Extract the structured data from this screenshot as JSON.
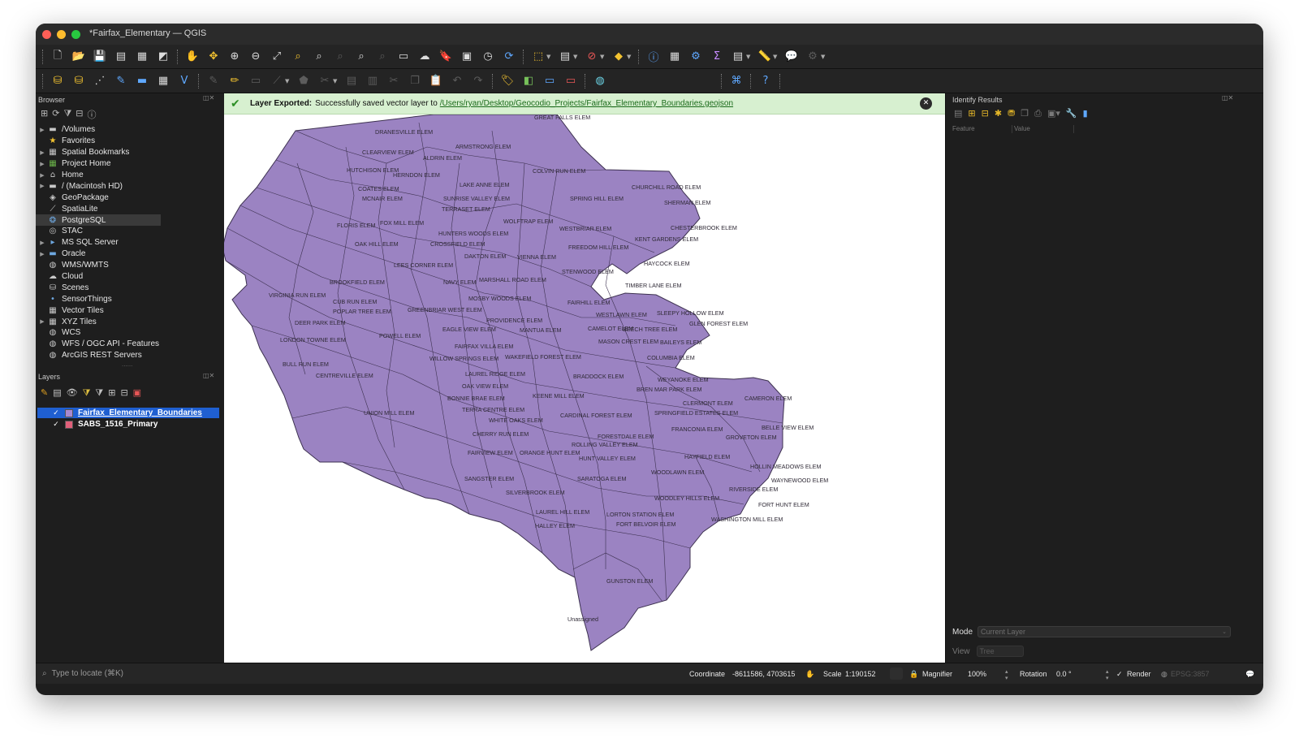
{
  "window": {
    "title": "*Fairfax_Elementary — QGIS"
  },
  "browser_panel": {
    "title": "Browser",
    "items": [
      {
        "label": "/Volumes",
        "icon": "folder-icon",
        "expandable": true
      },
      {
        "label": "Favorites",
        "icon": "star-icon",
        "expandable": false
      },
      {
        "label": "Spatial Bookmarks",
        "icon": "bookmark-icon",
        "expandable": true
      },
      {
        "label": "Project Home",
        "icon": "project-home-icon",
        "expandable": true
      },
      {
        "label": "Home",
        "icon": "home-folder-icon",
        "expandable": true
      },
      {
        "label": "/ (Macintosh HD)",
        "icon": "folder-icon",
        "expandable": true
      },
      {
        "label": "GeoPackage",
        "icon": "geopackage-icon",
        "expandable": false
      },
      {
        "label": "SpatiaLite",
        "icon": "spatialite-icon",
        "expandable": false
      },
      {
        "label": "PostgreSQL",
        "icon": "postgresql-icon",
        "expandable": false,
        "selected": true
      },
      {
        "label": "STAC",
        "icon": "stac-icon",
        "expandable": false
      },
      {
        "label": "MS SQL Server",
        "icon": "mssql-icon",
        "expandable": true
      },
      {
        "label": "Oracle",
        "icon": "oracle-icon",
        "expandable": true
      },
      {
        "label": "WMS/WMTS",
        "icon": "globe-icon",
        "expandable": false
      },
      {
        "label": "Cloud",
        "icon": "cloud-icon",
        "expandable": false
      },
      {
        "label": "Scenes",
        "icon": "scenes-icon",
        "expandable": false
      },
      {
        "label": "SensorThings",
        "icon": "sensor-icon",
        "expandable": false
      },
      {
        "label": "Vector Tiles",
        "icon": "grid-icon",
        "expandable": false
      },
      {
        "label": "XYZ Tiles",
        "icon": "grid-icon",
        "expandable": true
      },
      {
        "label": "WCS",
        "icon": "globe-icon",
        "expandable": false
      },
      {
        "label": "WFS / OGC API - Features",
        "icon": "globe-icon",
        "expandable": false
      },
      {
        "label": "ArcGIS REST Servers",
        "icon": "globe-icon",
        "expandable": false
      }
    ]
  },
  "layers_panel": {
    "title": "Layers",
    "layers": [
      {
        "name": "Fairfax_Elementary_Boundaries",
        "checked": true,
        "color": "#a889cf",
        "selected": true
      },
      {
        "name": "SABS_1516_Primary",
        "checked": true,
        "color": "#e0607a",
        "selected": false
      }
    ]
  },
  "message_bar": {
    "title": "Layer Exported:",
    "text": "Successfully saved vector layer to",
    "path": "/Users/ryan/Desktop/Geocodio_Projects/Fairfax_Elementary_Boundaries.geojson"
  },
  "map": {
    "fill_color": "#9b83c2",
    "stroke_color": "#3d3150",
    "labels": [
      {
        "text": "GREAT FALLS ELEM"
      },
      {
        "text": "DRANESVILLE ELEM"
      },
      {
        "text": "ARMSTRONG ELEM"
      },
      {
        "text": "CLEARVIEW ELEM"
      },
      {
        "text": "ALDRIN ELEM"
      },
      {
        "text": "HUTCHISON ELEM"
      },
      {
        "text": "HERNDON ELEM"
      },
      {
        "text": "COLVIN RUN ELEM"
      },
      {
        "text": "CHURCHILL ROAD ELEM"
      },
      {
        "text": "LAKE ANNE ELEM"
      },
      {
        "text": "COATES ELEM"
      },
      {
        "text": "SUNRISE VALLEY ELEM"
      },
      {
        "text": "SPRING HILL ELEM"
      },
      {
        "text": "SHERMAN ELEM"
      },
      {
        "text": "MCNAIR ELEM"
      },
      {
        "text": "TERRASET ELEM"
      },
      {
        "text": "WOLFTRAP ELEM"
      },
      {
        "text": "FLORIS ELEM"
      },
      {
        "text": "FOX MILL ELEM"
      },
      {
        "text": "WESTBRIAR ELEM"
      },
      {
        "text": "CHESTERBROOK ELEM"
      },
      {
        "text": "HUNTERS WOODS ELEM"
      },
      {
        "text": "KENT GARDENS ELEM"
      },
      {
        "text": "OAK HILL ELEM"
      },
      {
        "text": "CROSSFIELD ELEM"
      },
      {
        "text": "FREEDOM HILL ELEM"
      },
      {
        "text": "DAKTON ELEM"
      },
      {
        "text": "VIENNA ELEM"
      },
      {
        "text": "HAYCOCK ELEM"
      },
      {
        "text": "LEES CORNER ELEM"
      },
      {
        "text": "STENWOOD ELEM"
      },
      {
        "text": "NAVY ELEM"
      },
      {
        "text": "MARSHALL ROAD ELEM"
      },
      {
        "text": "BROOKFIELD ELEM"
      },
      {
        "text": "TIMBER LANE ELEM"
      },
      {
        "text": "VIRGINIA RUN ELEM"
      },
      {
        "text": "MOSBY WOODS ELEM"
      },
      {
        "text": "CUB RUN ELEM"
      },
      {
        "text": "FAIRHILL ELEM"
      },
      {
        "text": "POPLAR TREE ELEM"
      },
      {
        "text": "GREENBRIAR WEST ELEM"
      },
      {
        "text": "SLEEPY HOLLOW ELEM"
      },
      {
        "text": "WESTLAWN ELEM"
      },
      {
        "text": "PROVIDENCE ELEM"
      },
      {
        "text": "GLEN FOREST ELEM"
      },
      {
        "text": "DEER PARK ELEM"
      },
      {
        "text": "EAGLE VIEW ELEM"
      },
      {
        "text": "MANTUA ELEM"
      },
      {
        "text": "CAMELOT ELEM"
      },
      {
        "text": "BEECH TREE ELEM"
      },
      {
        "text": "POWELL ELEM"
      },
      {
        "text": "LONDON TOWNE ELEM"
      },
      {
        "text": "MASON CREST ELEM"
      },
      {
        "text": "BAILEYS ELEM"
      },
      {
        "text": "FAIRFAX VILLA ELEM"
      },
      {
        "text": "WILLOW SPRINGS ELEM"
      },
      {
        "text": "WAKEFIELD FOREST ELEM"
      },
      {
        "text": "COLUMBIA ELEM"
      },
      {
        "text": "BULL RUN ELEM"
      },
      {
        "text": "LAUREL RIDGE ELEM"
      },
      {
        "text": "CENTREVILLE ELEM"
      },
      {
        "text": "BRADDOCK ELEM"
      },
      {
        "text": "WEYANOKE ELEM"
      },
      {
        "text": "OAK VIEW ELEM"
      },
      {
        "text": "BREN MAR PARK ELEM"
      },
      {
        "text": "KEENE MILL ELEM"
      },
      {
        "text": "BONNIE BRAE ELEM"
      },
      {
        "text": "CAMERON ELEM"
      },
      {
        "text": "CLERMONT ELEM"
      },
      {
        "text": "TERRA CENTRE ELEM"
      },
      {
        "text": "UNION MILL ELEM"
      },
      {
        "text": "SPRINGFIELD ESTATES ELEM"
      },
      {
        "text": "CARDINAL FOREST ELEM"
      },
      {
        "text": "WHITE OAKS ELEM"
      },
      {
        "text": "BELLE VIEW ELEM"
      },
      {
        "text": "FRANCONIA ELEM"
      },
      {
        "text": "CHERRY RUN ELEM"
      },
      {
        "text": "GROVETON ELEM"
      },
      {
        "text": "FORESTDALE ELEM"
      },
      {
        "text": "ROLLING VALLEY ELEM"
      },
      {
        "text": "FAIRVIEW ELEM"
      },
      {
        "text": "ORANGE HUNT ELEM"
      },
      {
        "text": "HAYFIELD ELEM"
      },
      {
        "text": "HUNT VALLEY ELEM"
      },
      {
        "text": "HOLLIN MEADOWS ELEM"
      },
      {
        "text": "WOODLAWN ELEM"
      },
      {
        "text": "SANGSTER ELEM"
      },
      {
        "text": "SARATOGA ELEM"
      },
      {
        "text": "WAYNEWOOD ELEM"
      },
      {
        "text": "RIVERSIDE ELEM"
      },
      {
        "text": "SILVERBROOK ELEM"
      },
      {
        "text": "WOODLEY HILLS ELEM"
      },
      {
        "text": "FORT HUNT ELEM"
      },
      {
        "text": "LAUREL HILL ELEM"
      },
      {
        "text": "LORTON STATION ELEM"
      },
      {
        "text": "WASHINGTON MILL ELEM"
      },
      {
        "text": "HALLEY ELEM"
      },
      {
        "text": "FORT BELVOIR ELEM"
      },
      {
        "text": "GUNSTON ELEM"
      },
      {
        "text": "Unassigned"
      }
    ]
  },
  "identify_panel": {
    "title": "Identify Results",
    "col_feature": "Feature",
    "col_value": "Value",
    "mode_label": "Mode",
    "mode_value": "Current Layer",
    "view_label": "View",
    "view_value": "Tree"
  },
  "status_bar": {
    "locate_placeholder": "Type to locate (⌘K)",
    "coordinate_label": "Coordinate",
    "coordinate_value": "-8611586, 4703615",
    "scale_label": "Scale",
    "scale_value": "1:190152",
    "magnifier_label": "Magnifier",
    "magnifier_value": "100%",
    "rotation_label": "Rotation",
    "rotation_value": "0.0 °",
    "render_label": "Render",
    "crs_value": "EPSG:3857"
  }
}
